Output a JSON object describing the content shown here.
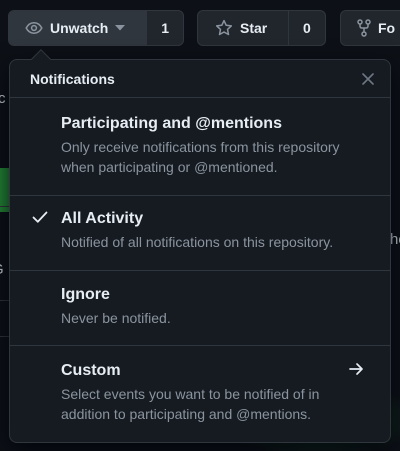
{
  "toolbar": {
    "unwatch_label": "Unwatch",
    "watch_count": "1",
    "star_label": "Star",
    "star_count": "0",
    "fork_label": "Fo"
  },
  "popover": {
    "title": "Notifications",
    "options": [
      {
        "title": "Participating and @mentions",
        "description": "Only receive notifications from this repository when participating or @mentioned.",
        "selected": false
      },
      {
        "title": "All Activity",
        "description": "Notified of all notifications on this repository.",
        "selected": true
      },
      {
        "title": "Ignore",
        "description": "Never be notified.",
        "selected": false
      },
      {
        "title": "Custom",
        "description": "Select events you want to be notified of in addition to participating and @mentions.",
        "selected": false
      }
    ]
  },
  "background": {
    "partial_chars": [
      "c",
      "he",
      "G"
    ]
  },
  "colors": {
    "background": "#0d1117",
    "surface": "#161b22",
    "button": "#21262d",
    "border": "#30363d",
    "text": "#e6edf3",
    "muted": "#8b949e",
    "accent_green": "#238636"
  },
  "icons": {
    "eye": "eye-icon",
    "caret": "triangle-down-icon",
    "star": "star-icon",
    "fork": "repo-forked-icon",
    "close": "close-icon",
    "check": "check-icon",
    "arrow": "arrow-right-icon"
  }
}
